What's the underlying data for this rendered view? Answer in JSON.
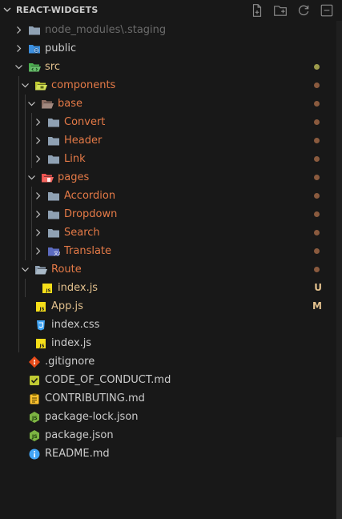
{
  "explorer": {
    "title": "REACT-WIDGETS",
    "actions": [
      {
        "name": "new-file-icon"
      },
      {
        "name": "new-folder-icon"
      },
      {
        "name": "refresh-icon"
      },
      {
        "name": "collapse-all-icon"
      }
    ]
  },
  "colors": {
    "modified": "#e2c08d",
    "untracked": "#73c991",
    "folder_changed": "#e57a47",
    "dim": "#6b6b6b",
    "text": "#cccccc"
  },
  "tree": [
    {
      "label": "node_modules\\.staging",
      "type": "folder",
      "icon": "folder-icon",
      "depth": 0,
      "twist": "closed",
      "state": "ignored"
    },
    {
      "label": "public",
      "type": "folder",
      "icon": "public-folder-icon",
      "depth": 0,
      "twist": "closed",
      "state": "normal"
    },
    {
      "label": "src",
      "type": "folder",
      "icon": "src-folder-icon",
      "depth": 0,
      "twist": "open",
      "state": "modified",
      "dot": "#9c9a4b"
    },
    {
      "label": "components",
      "type": "folder",
      "icon": "components-folder-icon",
      "depth": 1,
      "twist": "open",
      "state": "changed",
      "dot": "#8a5a3e"
    },
    {
      "label": "base",
      "type": "folder",
      "icon": "base-folder-icon",
      "depth": 2,
      "twist": "open",
      "state": "changed",
      "dot": "#8a5a3e"
    },
    {
      "label": "Convert",
      "type": "folder",
      "icon": "folder-icon",
      "depth": 3,
      "twist": "closed",
      "state": "changed",
      "dot": "#8a5a3e"
    },
    {
      "label": "Header",
      "type": "folder",
      "icon": "folder-icon",
      "depth": 3,
      "twist": "closed",
      "state": "changed",
      "dot": "#8a5a3e"
    },
    {
      "label": "Link",
      "type": "folder",
      "icon": "folder-icon",
      "depth": 3,
      "twist": "closed",
      "state": "changed",
      "dot": "#8a5a3e"
    },
    {
      "label": "pages",
      "type": "folder",
      "icon": "pages-folder-icon",
      "depth": 2,
      "twist": "open",
      "state": "changed",
      "dot": "#8a5a3e"
    },
    {
      "label": "Accordion",
      "type": "folder",
      "icon": "folder-icon",
      "depth": 3,
      "twist": "closed",
      "state": "changed",
      "dot": "#8a5a3e"
    },
    {
      "label": "Dropdown",
      "type": "folder",
      "icon": "folder-icon",
      "depth": 3,
      "twist": "closed",
      "state": "changed",
      "dot": "#8a5a3e"
    },
    {
      "label": "Search",
      "type": "folder",
      "icon": "folder-icon",
      "depth": 3,
      "twist": "closed",
      "state": "changed",
      "dot": "#8a5a3e"
    },
    {
      "label": "Translate",
      "type": "folder",
      "icon": "translate-folder-icon",
      "depth": 3,
      "twist": "closed",
      "state": "changed",
      "dot": "#8a5a3e"
    },
    {
      "label": "Route",
      "type": "folder",
      "icon": "folder-open-icon",
      "depth": 1,
      "twist": "open",
      "state": "changed",
      "dot": "#8a5a3e"
    },
    {
      "label": "index.js",
      "type": "file",
      "icon": "js-file-icon",
      "depth": 2,
      "state": "untracked",
      "deco": "U"
    },
    {
      "label": "App.js",
      "type": "file",
      "icon": "js-file-icon",
      "depth": 1,
      "state": "modified",
      "deco": "M"
    },
    {
      "label": "index.css",
      "type": "file",
      "icon": "css-file-icon",
      "depth": 1,
      "state": "normal"
    },
    {
      "label": "index.js",
      "type": "file",
      "icon": "js-file-icon",
      "depth": 1,
      "state": "normal"
    },
    {
      "label": ".gitignore",
      "type": "file",
      "icon": "git-icon",
      "depth": 0,
      "state": "normal"
    },
    {
      "label": "CODE_OF_CONDUCT.md",
      "type": "file",
      "icon": "checklist-icon",
      "depth": 0,
      "state": "normal"
    },
    {
      "label": "CONTRIBUTING.md",
      "type": "file",
      "icon": "clipboard-icon",
      "depth": 0,
      "state": "normal"
    },
    {
      "label": "package-lock.json",
      "type": "file",
      "icon": "nodejs-icon",
      "depth": 0,
      "state": "normal"
    },
    {
      "label": "package.json",
      "type": "file",
      "icon": "nodejs-icon",
      "depth": 0,
      "state": "normal"
    },
    {
      "label": "README.md",
      "type": "file",
      "icon": "info-icon",
      "depth": 0,
      "state": "normal"
    }
  ]
}
